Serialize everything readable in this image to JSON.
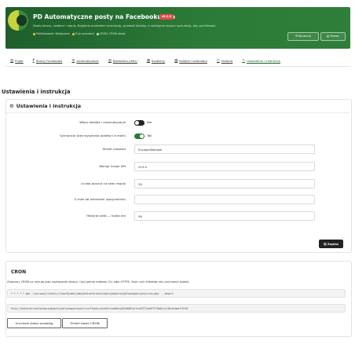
{
  "header": {
    "title": "PD Automatyczne posty na Facebooku Pro",
    "version": "v5.2.0",
    "subtitle": "Dodaj strony, szablon i reguły. Najpierw przetwórz symulację, sprawdź kolejkę, a następnie wyłącz symulację, aby publikować.",
    "status": [
      "Publikowanie: Wyłączone",
      "Tryb symulacji",
      "CRON: CRON dodaj"
    ],
    "status_colors": [
      "#f2c94c",
      "#f2c94c",
      "#cfe6cf"
    ],
    "btn_connect": "Kontroluj",
    "btn_docs": "Pomoc"
  },
  "tabs": [
    {
      "icon": "chart-icon",
      "glyph": "▥",
      "label": "Pulpit"
    },
    {
      "icon": "facebook-icon",
      "glyph": "f",
      "label": "Strony Facebooka"
    },
    {
      "icon": "gear-icon",
      "glyph": "⚙",
      "label": "Automatyzacja"
    },
    {
      "icon": "library-icon",
      "glyph": "▤",
      "label": "Biblioteka (reks)"
    },
    {
      "icon": "template-icon",
      "glyph": "▦",
      "label": "Szablony"
    },
    {
      "icon": "calendar-icon",
      "glyph": "▦",
      "label": "Kolejka i kalendarz"
    },
    {
      "icon": "clock-icon",
      "glyph": "◷",
      "label": "Historia"
    },
    {
      "icon": "pencil-icon",
      "glyph": "✎",
      "label": "Ustawienia i instrukcja"
    }
  ],
  "page": {
    "section_title": "Ustawienia i instrukcja"
  },
  "settings": {
    "card_title": "Ustawienia i instrukcja",
    "queue_label": "Włącz kolejkę i automatyzacje",
    "queue_value": "Nie",
    "sim_label": "Symulacja (bez wysyłania postów i e-maili)",
    "sim_value": "Tak",
    "tz_label": "Strefa czasowa",
    "tz_value": "Europe/Warsaw",
    "api_label": "Wersja Graph API",
    "api_value": "v23.0",
    "count_label": "Liczba pozycji na skan reguły",
    "count_value": "50",
    "email_label": "E-mail do ostrzeżeń (opcjonalnie)",
    "email_value": "",
    "hist_label": "Historia prób — liczba dni",
    "hist_value": "90",
    "save_label": "Zapisz"
  },
  "cron": {
    "title": "CRON",
    "desc": "Zalecany CRON co minutę jako użytkownik sklepu. Użyj jednej metody: CLI albo HTTPS. Sam ruch klientów nie uruchamia kolejki.",
    "cli": "* * * * * php '/var/www/clients/client0/web1/web/pdstoretranslatepro/modules/pdfautopostspro/cron.php' --shop=1",
    "http": "http://pdstoretranslatepro/module/pdfautopostspro/cron?token=4c4a9cfca4d6ca422e0687ac7cc037f1ed073ff5b6c1cc3bcbfadefc97e9",
    "run_once": "Uruchom jeden przebieg",
    "change_token": "Zmień token CRON"
  }
}
